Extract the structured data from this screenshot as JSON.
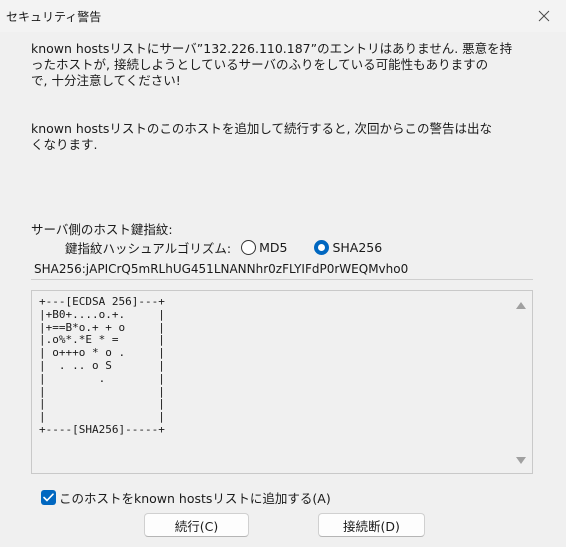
{
  "window": {
    "title": "セキュリティ警告"
  },
  "message": {
    "line1": "known hostsリストにサーバ”132.226.110.187”のエントリはありません. 悪意を持\nったホストが, 接続しようとしているサーバのふりをしている可能性もありますの\nで, 十分注意してください!",
    "line2": "known hostsリストのこのホストを追加して続行すると, 次回からこの警告は出な\nくなります."
  },
  "fingerprint": {
    "label": "サーバ側のホスト鍵指紋:",
    "algo_label": "鍵指紋ハッシュアルゴリズム:",
    "options": [
      {
        "label": "MD5",
        "selected": false
      },
      {
        "label": "SHA256",
        "selected": true
      }
    ],
    "value": "SHA256:jAPICrQ5mRLhUG451LNANNhr0zFLYIFdP0rWEQMvho0"
  },
  "randomart": "+---[ECDSA 256]---+\n|+B0+....o.+.     |\n|+==B*o.+ + o     |\n|.o%*.*E * =      |\n| o+++o * o .     |\n|  . .. o S       |\n|        .        |\n|                 |\n|                 |\n|                 |\n+----[SHA256]-----+",
  "checkbox": {
    "label": "このホストをknown hostsリストに追加する(A)",
    "checked": true
  },
  "buttons": {
    "continue": "続行(C)",
    "disconnect": "接続断(D)"
  },
  "colors": {
    "accent": "#0067c0"
  }
}
